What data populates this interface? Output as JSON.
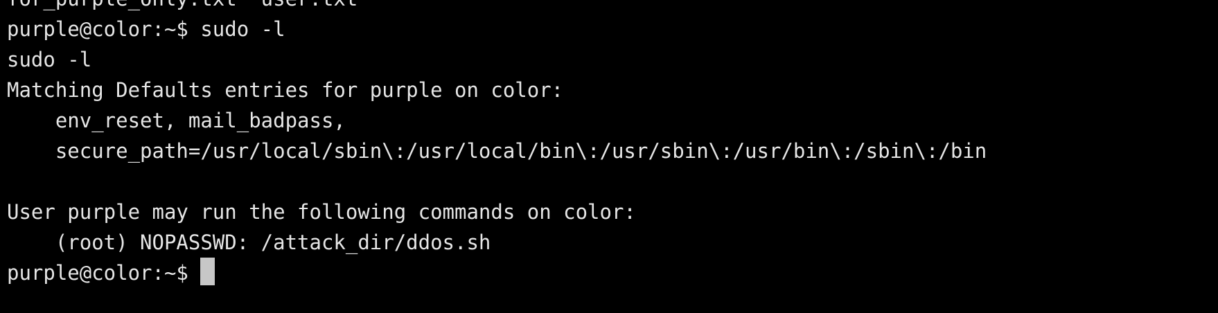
{
  "terminal": {
    "lines": [
      "for_purple_only.txt  user.txt",
      "purple@color:~$ sudo -l",
      "sudo -l",
      "Matching Defaults entries for purple on color:",
      "    env_reset, mail_badpass,",
      "    secure_path=/usr/local/sbin\\:/usr/local/bin\\:/usr/sbin\\:/usr/bin\\:/sbin\\:/bin",
      "",
      "User purple may run the following commands on color:",
      "    (root) NOPASSWD: /attack_dir/ddos.sh"
    ],
    "prompt": "purple@color:~$ ",
    "colors": {
      "background": "#000000",
      "text": "#e6e6e6",
      "cursor": "#c7c7c7"
    }
  }
}
